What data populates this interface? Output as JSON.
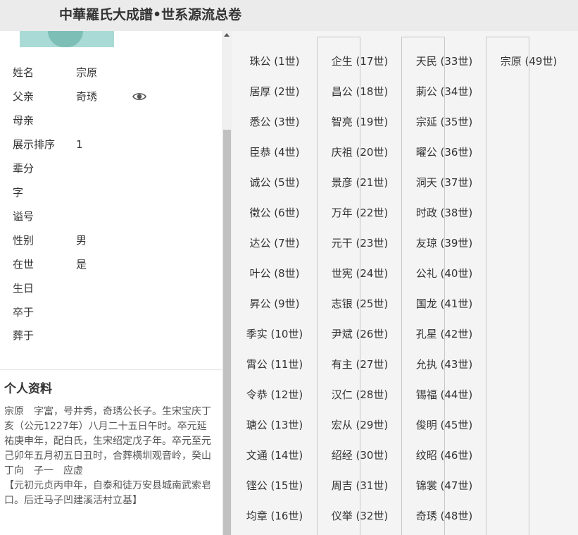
{
  "header": {
    "title": "中華羅氏大成譜•世系源流总卷"
  },
  "profile": {
    "rows": [
      {
        "label": "姓名",
        "value": "宗原"
      },
      {
        "label": "父亲",
        "value": "奇琇"
      },
      {
        "label": "母亲",
        "value": ""
      },
      {
        "label": "展示排序",
        "value": "1"
      },
      {
        "label": "辈分",
        "value": ""
      },
      {
        "label": "字",
        "value": ""
      },
      {
        "label": "谥号",
        "value": ""
      },
      {
        "label": "性别",
        "value": "男"
      },
      {
        "label": "在世",
        "value": "是"
      },
      {
        "label": "生日",
        "value": ""
      },
      {
        "label": "卒于",
        "value": ""
      },
      {
        "label": "葬于",
        "value": ""
      }
    ],
    "eye_icon": "eye-icon"
  },
  "bio": {
    "title": "个人资料",
    "paragraphs": [
      "宗原　字富，号井秀，奇琇公长子。生宋宝庆丁亥（公元1227年）八月二十五日午时。卒元延祐庚申年，配白氏，生宋绍定戊子年。卒元至元己卯年五月初五日丑时，合葬横圳观音岭，癸山丁向　子一　应虚",
      "【元初元贞丙申年，自泰和徒万安县城南武索皂口。后迁马子凹建溪活村立基】"
    ]
  },
  "generations": {
    "columns": [
      [
        "珠公 (1世)",
        "居厚 (2世)",
        "悉公 (3世)",
        "臣恭 (4世)",
        "诚公 (5世)",
        "徵公 (6世)",
        "达公 (7世)",
        "叶公 (8世)",
        "昇公 (9世)",
        "季实 (10世)",
        "霄公 (11世)",
        "令恭 (12世)",
        "瑭公 (13世)",
        "文通 (14世)",
        "铿公 (15世)",
        "均章 (16世)"
      ],
      [
        "企生 (17世)",
        "昌公 (18世)",
        "智亮 (19世)",
        "庆祖 (20世)",
        "景彦 (21世)",
        "万年 (22世)",
        "元干 (23世)",
        "世宪 (24世)",
        "志银 (25世)",
        "尹斌 (26世)",
        "有主 (27世)",
        "汉仁 (28世)",
        "宏从 (29世)",
        "绍经 (30世)",
        "周吉 (31世)",
        "仪举 (32世)"
      ],
      [
        "天民 (33世)",
        "莿公 (34世)",
        "宗延 (35世)",
        "曜公 (36世)",
        "洞天 (37世)",
        "时政 (38世)",
        "友琼 (39世)",
        "公礼 (40世)",
        "国龙 (41世)",
        "孔星 (42世)",
        "允执 (43世)",
        "锡福 (44世)",
        "俊明 (45世)",
        "纹昭 (46世)",
        "锦裳 (47世)",
        "奇琇 (48世)"
      ],
      [
        "宗原 (49世)"
      ]
    ]
  }
}
